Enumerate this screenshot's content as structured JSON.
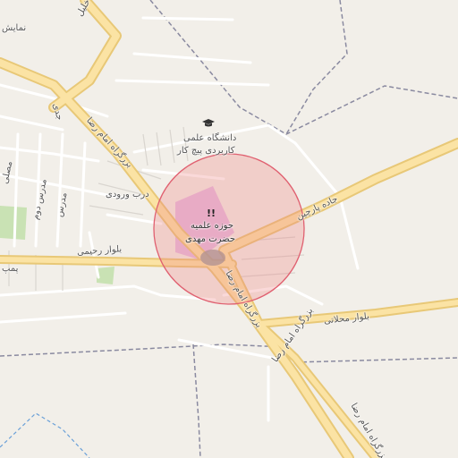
{
  "map": {
    "labels": {
      "university_line1": "دانشگاه علمی",
      "university_line2": "کاربردی پیچ کار",
      "seminary_line1": "حوزه علمیه",
      "seminary_line2": "حضرت مهدی",
      "parchin_road": "جاده پارچین",
      "imam_reza_blvd_north": "بزرگراه امام رضا",
      "imam_reza_blvd_mid": "بزرگراه امام رضا",
      "imam_reza_blvd_south": "بزرگراه امام رضا",
      "mahallati_blvd": "بلوار محلاتی",
      "rahimi_blvd": "بلوار رحیمی",
      "darb_vorudi": "درب ورودی",
      "jeddi": "جدی",
      "modarres_dovom": "مدرس دوم",
      "modarres_1": "مدرس",
      "mosalla": "مصلی",
      "khalil": "خلیل",
      "namayesh": "نمایش",
      "pump": "پمپ"
    },
    "icons": {
      "university": "graduation-cap-icon",
      "poi": "exclamation-poi-icon"
    },
    "colors": {
      "background": "#f2efe9",
      "major_road": "#fbe3a4",
      "major_road_casing": "#e8c877",
      "minor_road": "#ffffff",
      "boundary": "#8a8aa0",
      "highlight_fill": "#f08080",
      "poi_area": "#e6bde2",
      "park": "#c9e2b4"
    },
    "highlight": {
      "label": ""
    }
  }
}
